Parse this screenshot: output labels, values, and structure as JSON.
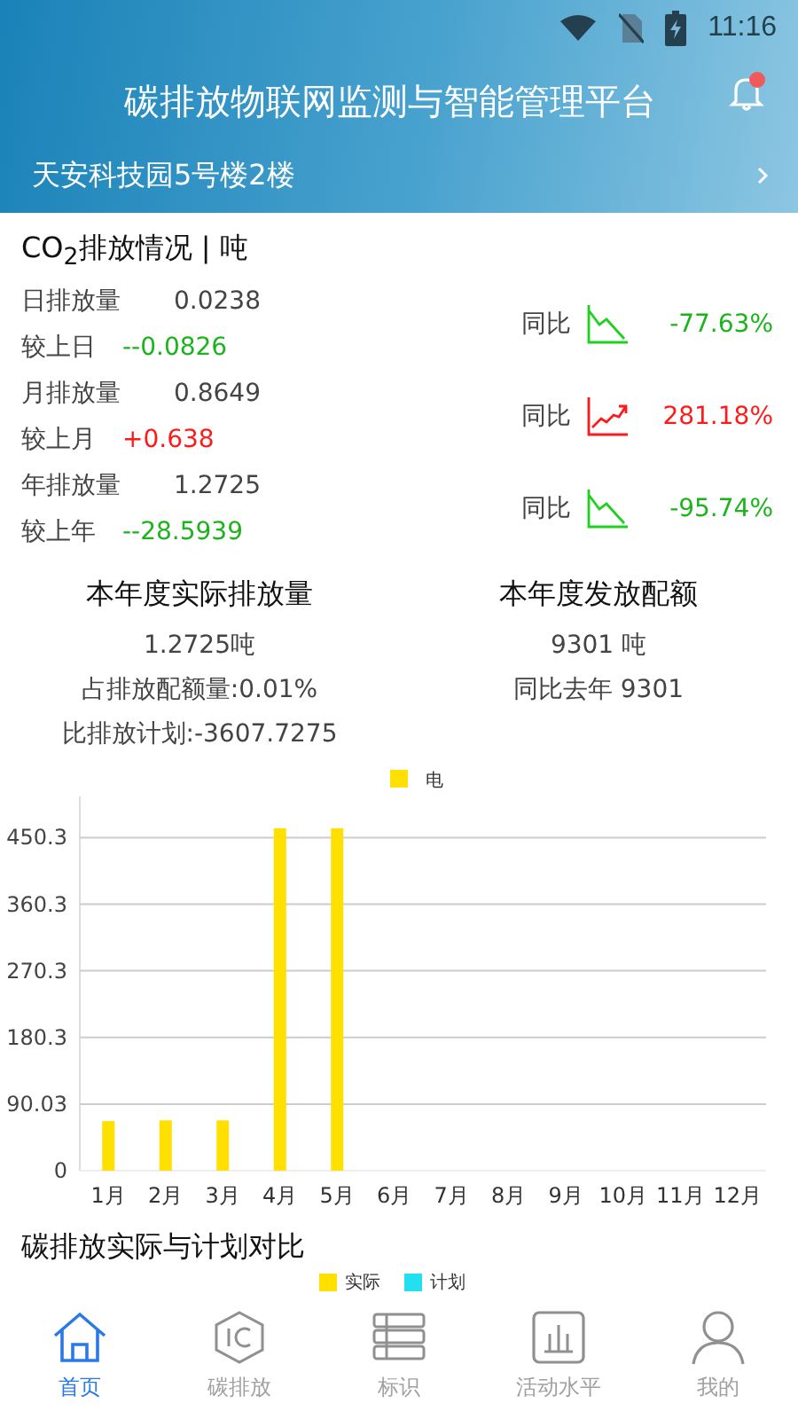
{
  "status_bar": {
    "time": "11:16"
  },
  "header": {
    "title": "碳排放物联网监测与智能管理平台",
    "location": "天安科技园5号楼2楼",
    "notification": true
  },
  "emissions": {
    "title": "CO$_{2}$排放情况 | 吨",
    "groups": [
      {
        "label": "日排放量",
        "value": "0.0238",
        "compare_label": "较上日",
        "change": "--0.0826",
        "kind": "down",
        "yoy_label": "同比",
        "yoy": "-77.63%"
      },
      {
        "label": "月排放量",
        "value": "0.8649",
        "compare_label": "较上月",
        "change": "+0.638",
        "kind": "up",
        "yoy_label": "同比",
        "yoy": "281.18%"
      },
      {
        "label": "年排放量",
        "value": "1.2725",
        "compare_label": "较上年",
        "change": "--28.5939",
        "kind": "down",
        "yoy_label": "同比",
        "yoy": "-95.74%"
      }
    ]
  },
  "summary": [
    {
      "title": "本年度实际排放量",
      "lines": [
        "1.2725吨",
        "占排放配额量:0.01%",
        "比排放计划:-3607.7275"
      ]
    },
    {
      "title": "本年度发放配额",
      "lines": [
        "9301 吨",
        "同比去年 9301"
      ]
    }
  ],
  "chart_data": {
    "type": "bar",
    "categories": [
      "1月",
      "2月",
      "3月",
      "4月",
      "5月",
      "6月",
      "7月",
      "8月",
      "9月",
      "10月",
      "11月",
      "12月"
    ],
    "series": [
      {
        "name": "电",
        "color": "#ffe000",
        "values": [
          67,
          68,
          68,
          463,
          463,
          0,
          0,
          0,
          0,
          0,
          0,
          0
        ]
      }
    ],
    "ylim": [
      0,
      506
    ],
    "grid": true,
    "yticks": [
      0,
      90.03,
      180.3,
      270.3,
      360.3,
      450.3
    ]
  },
  "comparison": {
    "title": "碳排放实际与计划对比",
    "legend": [
      {
        "name": "实际",
        "color": "#ffe000"
      },
      {
        "name": "计划",
        "color": "#22e0f0"
      }
    ]
  },
  "nav": [
    {
      "kind": "home",
      "label": "首页",
      "selected": true
    },
    {
      "kind": "carbon",
      "label": "碳排放",
      "selected": false
    },
    {
      "kind": "list",
      "label": "标识",
      "selected": false
    },
    {
      "kind": "activity",
      "label": "活动水平",
      "selected": false
    },
    {
      "kind": "user",
      "label": "我的",
      "selected": false
    }
  ]
}
